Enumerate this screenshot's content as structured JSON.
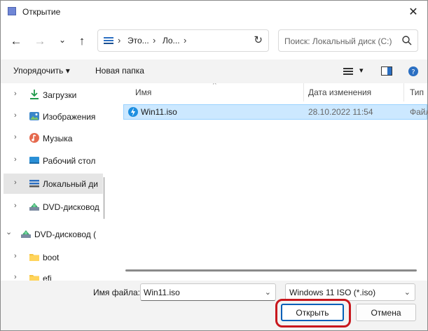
{
  "window": {
    "title": "Открытие",
    "close_glyph": "✕"
  },
  "nav": {
    "back_glyph": "←",
    "forward_glyph": "→",
    "recent_glyph": "⌄",
    "up_glyph": "↑",
    "breadcrumbs": [
      "Это...",
      "Ло..."
    ],
    "crumb_sep": "›",
    "refresh_glyph": "↻",
    "search_placeholder": "Поиск: Локальный диск (C:)"
  },
  "toolbar": {
    "organize": "Упорядочить",
    "organize_chevron": "▾",
    "new_folder": "Новая папка",
    "view_chevron": "▾"
  },
  "sidebar": {
    "items": [
      {
        "label": "Загрузки",
        "icon": "download-icon",
        "chevron": "›"
      },
      {
        "label": "Изображения",
        "icon": "pictures-icon",
        "chevron": "›"
      },
      {
        "label": "Музыка",
        "icon": "music-icon",
        "chevron": "›"
      },
      {
        "label": "Рабочий стол",
        "icon": "desktop-icon",
        "chevron": "›"
      },
      {
        "label": "Локальный ди",
        "icon": "drive-icon",
        "chevron": "›",
        "selected": true
      },
      {
        "label": "DVD-дисковод",
        "icon": "dvd-icon",
        "chevron": "›"
      },
      {
        "label": "DVD-дисковод (",
        "icon": "dvd-icon",
        "chevron": "⌄"
      },
      {
        "label": "boot",
        "icon": "folder-icon",
        "chevron": "›"
      },
      {
        "label": "efi",
        "icon": "folder-icon",
        "chevron": "›"
      }
    ]
  },
  "files": {
    "columns": {
      "name": "Имя",
      "date": "Дата изменения",
      "type": "Тип"
    },
    "sort_glyph": "^",
    "rows": [
      {
        "name": "Win11.iso",
        "date": "28.10.2022 11:54",
        "type": "Файл",
        "icon": "iso-file-icon",
        "selected": true
      }
    ]
  },
  "bottom": {
    "filename_label": "Имя файла:",
    "filename_value": "Win11.iso",
    "dropdown_glyph": "⌄",
    "filetype_value": "Windows 11 ISO (*.iso)",
    "open_label": "Открыть",
    "cancel_label": "Отмена"
  },
  "colors": {
    "accent": "#005fb8",
    "selection": "#cce8ff",
    "highlight_ring": "#c8171d"
  }
}
